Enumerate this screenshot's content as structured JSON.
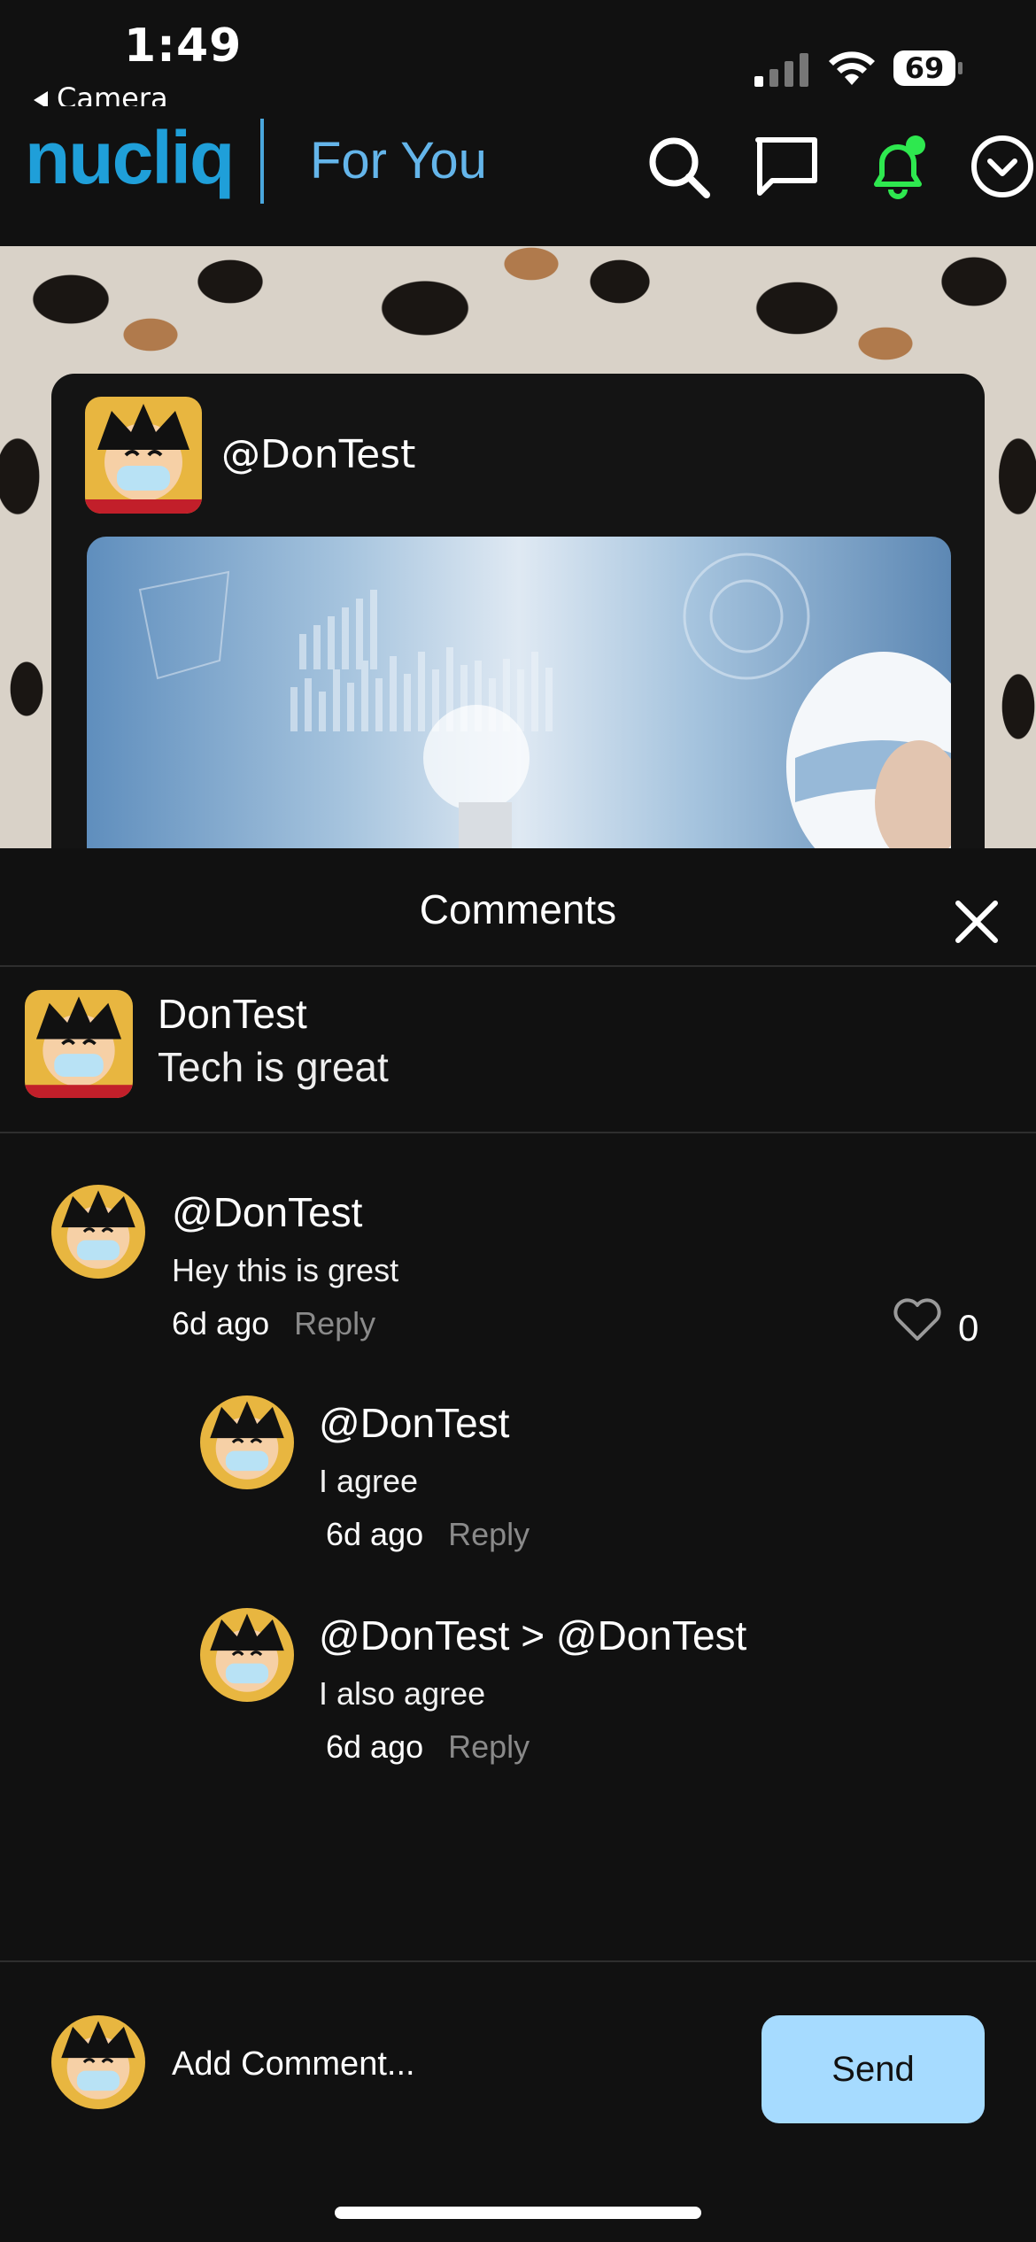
{
  "status_bar": {
    "time": "1:49",
    "back_label": "Camera",
    "battery_level": "69"
  },
  "header": {
    "logo_text": "nucliq",
    "feed_tab": "For You",
    "notification_dot_color": "#2ee84f",
    "icons": [
      "search-icon",
      "chat-icon",
      "bell-icon",
      "chevron-circle-icon"
    ]
  },
  "post": {
    "username": "@DonTest"
  },
  "comments_sheet": {
    "title": "Comments",
    "post_summary": {
      "name": "DonTest",
      "caption": "Tech is great"
    },
    "comments": [
      {
        "user": "@DonTest",
        "text": "Hey this is grest",
        "time": "6d ago",
        "reply_label": "Reply",
        "like_count": "0"
      }
    ],
    "replies": [
      {
        "user": "@DonTest",
        "text": "I agree",
        "time": "6d ago",
        "reply_label": "Reply"
      },
      {
        "user": "@DonTest > @DonTest",
        "text": "I also agree",
        "time": "6d ago",
        "reply_label": "Reply"
      }
    ]
  },
  "composer": {
    "placeholder": "Add Comment...",
    "send_label": "Send"
  },
  "colors": {
    "background": "#111111",
    "accent_blue": "#1f9fd9",
    "send_button": "#a6dbff"
  }
}
